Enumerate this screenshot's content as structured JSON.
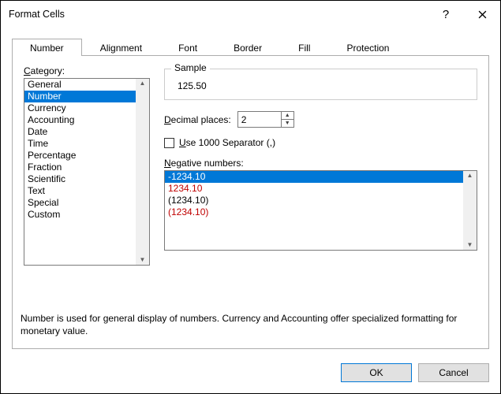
{
  "title": "Format Cells",
  "titlebar": {
    "help_label": "?",
    "close_label": "×"
  },
  "tabs": [
    {
      "label": "Number",
      "active": true
    },
    {
      "label": "Alignment",
      "active": false
    },
    {
      "label": "Font",
      "active": false
    },
    {
      "label": "Border",
      "active": false
    },
    {
      "label": "Fill",
      "active": false
    },
    {
      "label": "Protection",
      "active": false
    }
  ],
  "category": {
    "label_pre": "",
    "label_accel": "C",
    "label_post": "ategory:",
    "items": [
      "General",
      "Number",
      "Currency",
      "Accounting",
      "Date",
      "Time",
      "Percentage",
      "Fraction",
      "Scientific",
      "Text",
      "Special",
      "Custom"
    ],
    "selected_index": 1
  },
  "sample": {
    "legend": "Sample",
    "value": "125.50"
  },
  "decimal": {
    "label_accel": "D",
    "label_post": "ecimal places:",
    "value": "2"
  },
  "thousand_sep": {
    "accel": "U",
    "post": "se 1000 Separator (,)",
    "checked": false
  },
  "negative": {
    "accel": "N",
    "post": "egative numbers:",
    "items": [
      {
        "text": "-1234.10",
        "red": false
      },
      {
        "text": "1234.10",
        "red": true
      },
      {
        "text": "(1234.10)",
        "red": false
      },
      {
        "text": "(1234.10)",
        "red": true
      }
    ],
    "selected_index": 0
  },
  "description": "Number is used for general display of numbers.  Currency and Accounting offer specialized formatting for monetary value.",
  "buttons": {
    "ok": "OK",
    "cancel": "Cancel"
  }
}
